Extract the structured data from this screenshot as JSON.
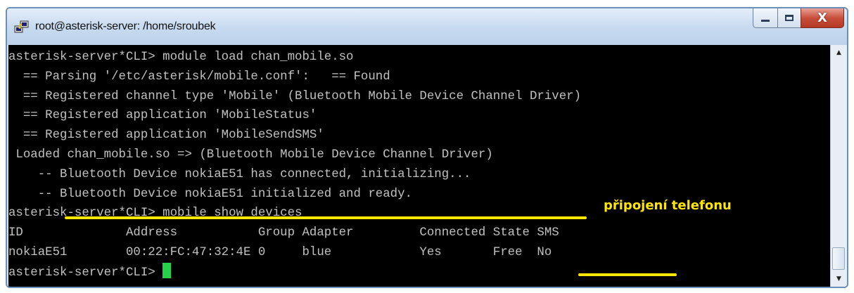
{
  "window": {
    "title": "root@asterisk-server: /home/sroubek",
    "icon": "putty-icon",
    "controls": {
      "minimize_icon": "minimize-icon",
      "maximize_icon": "maximize-icon",
      "close_label": "X"
    }
  },
  "terminal": {
    "background": "#000000",
    "foreground": "#c0c0c0",
    "lines": [
      "asterisk-server*CLI> module load chan_mobile.so",
      "  == Parsing '/etc/asterisk/mobile.conf':   == Found",
      "  == Registered channel type 'Mobile' (Bluetooth Mobile Device Channel Driver)",
      "  == Registered application 'MobileStatus'",
      "  == Registered application 'MobileSendSMS'",
      " Loaded chan_mobile.so => (Bluetooth Mobile Device Channel Driver)",
      "    -- Bluetooth Device nokiaE51 has connected, initializing...",
      "    -- Bluetooth Device nokiaE51 initialized and ready.",
      "asterisk-server*CLI> mobile show devices",
      "ID              Address           Group Adapter         Connected State SMS",
      "nokiaE51        00:22:FC:47:32:4E 0     blue            Yes       Free  No"
    ],
    "prompt": "asterisk-server*CLI> ",
    "cursor_color": "#27d14a"
  },
  "annotation": {
    "text": "připojení telefonu",
    "color": "#ffe600"
  }
}
